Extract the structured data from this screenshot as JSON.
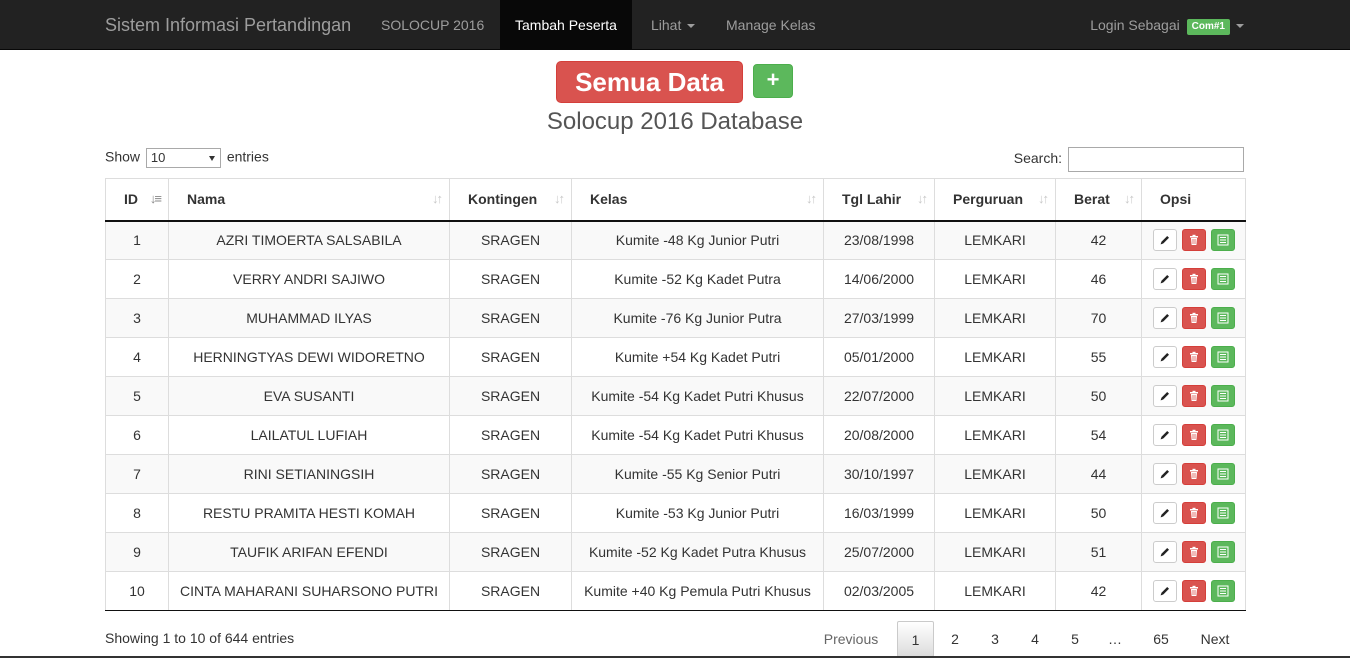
{
  "navbar": {
    "brand": "Sistem Informasi Pertandingan",
    "items": [
      {
        "label": "SOLOCUP 2016"
      },
      {
        "label": "Tambah Peserta"
      },
      {
        "label": "Lihat"
      },
      {
        "label": "Manage Kelas"
      }
    ],
    "login_label": "Login Sebagai",
    "login_badge": "Com#1"
  },
  "heading": {
    "all_button": "Semua Data",
    "add_button": "+",
    "title": "Solocup 2016 Database"
  },
  "controls": {
    "show_label": "Show",
    "page_length": "10",
    "entries_label": "entries",
    "search_label": "Search:"
  },
  "table": {
    "columns": [
      "ID",
      "Nama",
      "Kontingen",
      "Kelas",
      "Tgl Lahir",
      "Perguruan",
      "Berat",
      "Opsi"
    ],
    "rows": [
      [
        "1",
        "AZRI TIMOERTA SALSABILA",
        "SRAGEN",
        "Kumite -48 Kg Junior Putri",
        "23/08/1998",
        "LEMKARI",
        "42"
      ],
      [
        "2",
        "VERRY ANDRI SAJIWO",
        "SRAGEN",
        "Kumite -52 Kg Kadet Putra",
        "14/06/2000",
        "LEMKARI",
        "46"
      ],
      [
        "3",
        "MUHAMMAD ILYAS",
        "SRAGEN",
        "Kumite -76 Kg Junior Putra",
        "27/03/1999",
        "LEMKARI",
        "70"
      ],
      [
        "4",
        "HERNINGTYAS DEWI WIDORETNO",
        "SRAGEN",
        "Kumite +54 Kg Kadet Putri",
        "05/01/2000",
        "LEMKARI",
        "55"
      ],
      [
        "5",
        "EVA SUSANTI",
        "SRAGEN",
        "Kumite -54 Kg Kadet Putri Khusus",
        "22/07/2000",
        "LEMKARI",
        "50"
      ],
      [
        "6",
        "LAILATUL LUFIAH",
        "SRAGEN",
        "Kumite -54 Kg Kadet Putri Khusus",
        "20/08/2000",
        "LEMKARI",
        "54"
      ],
      [
        "7",
        "RINI SETIANINGSIH",
        "SRAGEN",
        "Kumite -55 Kg Senior Putri",
        "30/10/1997",
        "LEMKARI",
        "44"
      ],
      [
        "8",
        "RESTU PRAMITA HESTI KOMAH",
        "SRAGEN",
        "Kumite -53 Kg Junior Putri",
        "16/03/1999",
        "LEMKARI",
        "50"
      ],
      [
        "9",
        "TAUFIK ARIFAN EFENDI",
        "SRAGEN",
        "Kumite -52 Kg Kadet Putra Khusus",
        "25/07/2000",
        "LEMKARI",
        "51"
      ],
      [
        "10",
        "CINTA MAHARANI SUHARSONO PUTRI",
        "SRAGEN",
        "Kumite +40 Kg Pemula Putri Khusus",
        "02/03/2005",
        "LEMKARI",
        "42"
      ]
    ]
  },
  "footer": {
    "info": "Showing 1 to 10 of 644 entries",
    "pagination": {
      "previous": "Previous",
      "pages": [
        "1",
        "2",
        "3",
        "4",
        "5"
      ],
      "ellipsis": "…",
      "last": "65",
      "next": "Next",
      "current": "1"
    }
  },
  "icons": {
    "edit": "pencil-icon",
    "delete": "trash-icon",
    "view": "list-icon"
  },
  "colors": {
    "navbar_bg": "#222222",
    "danger": "#d9534f",
    "success": "#5cb85c"
  }
}
